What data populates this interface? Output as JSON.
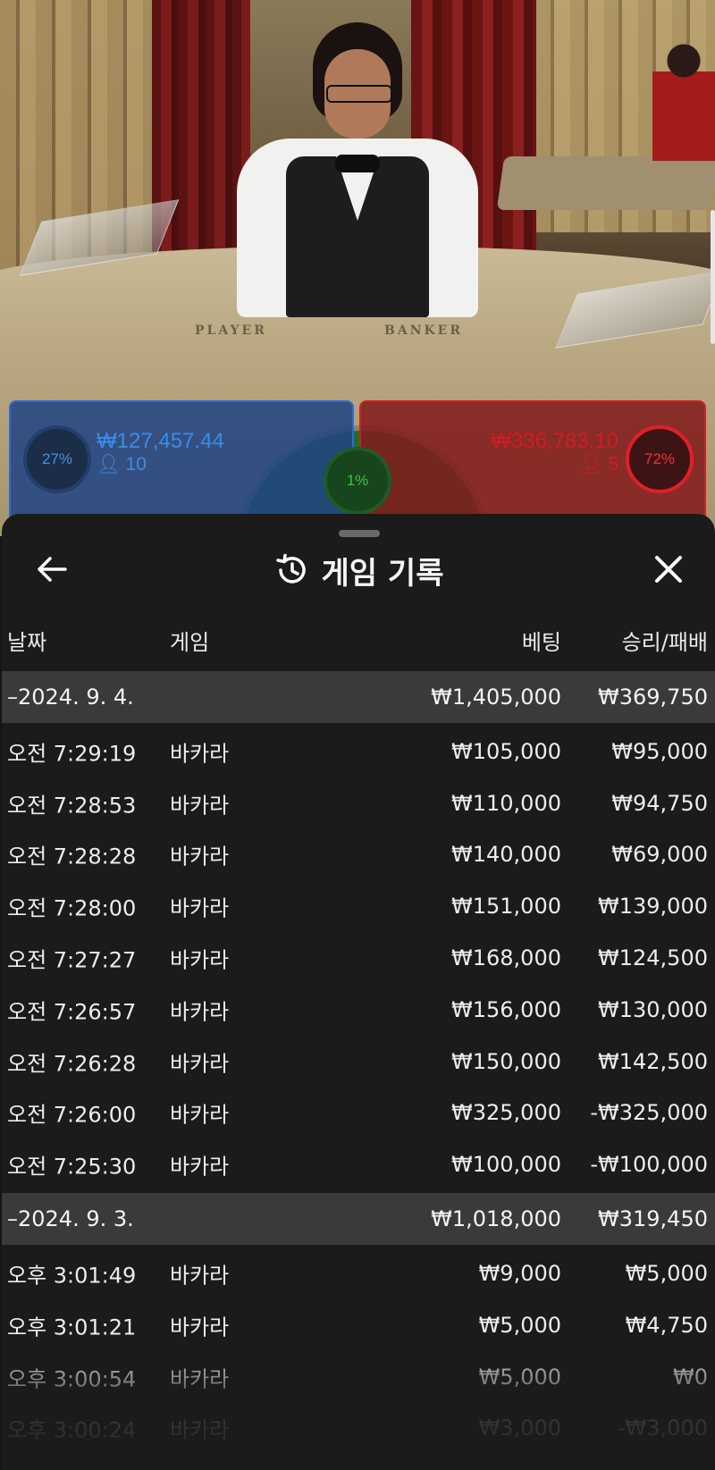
{
  "video": {
    "table_labels": {
      "player": "PLAYER",
      "banker": "BANKER"
    },
    "player_bets": {
      "percent": "27%",
      "amount": "₩127,457.44",
      "bettors": "10",
      "color": "#3b8be8"
    },
    "banker_bets": {
      "percent": "72%",
      "amount": "₩336,783.10",
      "bettors": "5",
      "color": "#d01c24"
    },
    "tie_bets": {
      "percent": "1%",
      "color": "#45c046"
    }
  },
  "sheet": {
    "title": "게임 기록",
    "icons": {
      "back": "arrow-left-icon",
      "history": "history-icon",
      "close": "close-icon"
    },
    "columns": {
      "date": "날짜",
      "game": "게임",
      "bet": "베팅",
      "result": "승리/패배"
    },
    "groups": [
      {
        "date": "–2024. 9. 4.",
        "total_bet": "₩1,405,000",
        "total_result": "₩369,750",
        "rows": [
          {
            "time": "오전 7:29:19",
            "game": "바카라",
            "bet": "₩105,000",
            "result": "₩95,000"
          },
          {
            "time": "오전 7:28:53",
            "game": "바카라",
            "bet": "₩110,000",
            "result": "₩94,750"
          },
          {
            "time": "오전 7:28:28",
            "game": "바카라",
            "bet": "₩140,000",
            "result": "₩69,000"
          },
          {
            "time": "오전 7:28:00",
            "game": "바카라",
            "bet": "₩151,000",
            "result": "₩139,000"
          },
          {
            "time": "오전 7:27:27",
            "game": "바카라",
            "bet": "₩168,000",
            "result": "₩124,500"
          },
          {
            "time": "오전 7:26:57",
            "game": "바카라",
            "bet": "₩156,000",
            "result": "₩130,000"
          },
          {
            "time": "오전 7:26:28",
            "game": "바카라",
            "bet": "₩150,000",
            "result": "₩142,500"
          },
          {
            "time": "오전 7:26:00",
            "game": "바카라",
            "bet": "₩325,000",
            "result": "-₩325,000"
          },
          {
            "time": "오전 7:25:30",
            "game": "바카라",
            "bet": "₩100,000",
            "result": "-₩100,000"
          }
        ]
      },
      {
        "date": "–2024. 9. 3.",
        "total_bet": "₩1,018,000",
        "total_result": "₩319,450",
        "rows": [
          {
            "time": "오후 3:01:49",
            "game": "바카라",
            "bet": "₩9,000",
            "result": "₩5,000"
          },
          {
            "time": "오후 3:01:21",
            "game": "바카라",
            "bet": "₩5,000",
            "result": "₩4,750"
          },
          {
            "time": "오후 3:00:54",
            "game": "바카라",
            "bet": "₩5,000",
            "result": "₩0"
          },
          {
            "time": "오후 3:00:24",
            "game": "바카라",
            "bet": "₩3,000",
            "result": "-₩3,000"
          }
        ]
      }
    ]
  }
}
